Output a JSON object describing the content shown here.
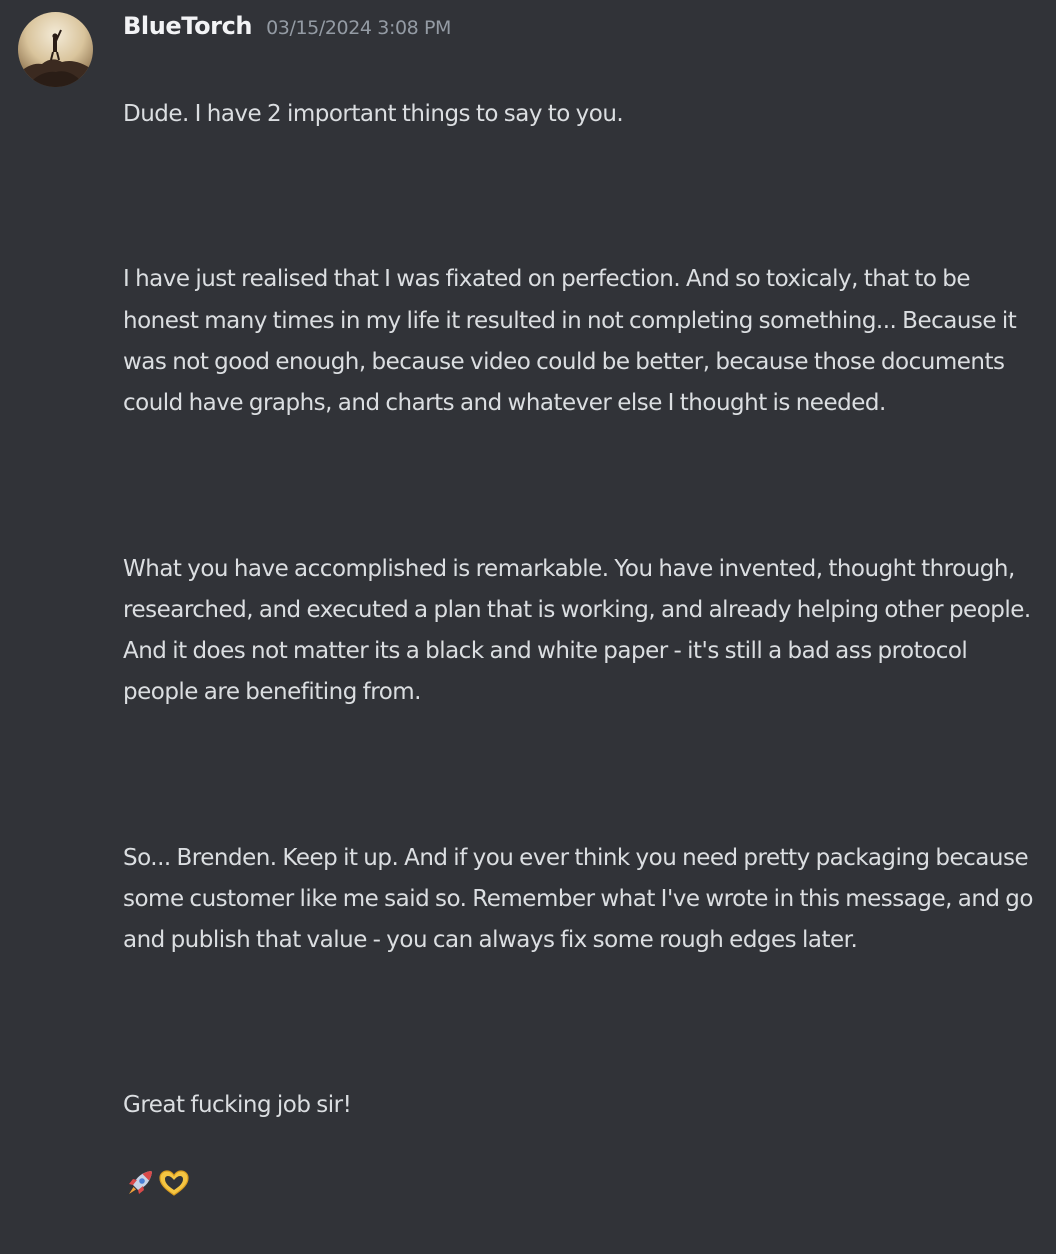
{
  "message": {
    "author": "BlueTorch",
    "timestamp": "03/15/2024 3:08 PM",
    "paragraphs": [
      "Dude. I have 2 important things to say to you.",
      "I have just realised that I was fixated on perfection. And so toxicaly, that to be honest many times in my life it resulted in not completing something... Because it was not good enough, because video could be better, because those documents could have graphs, and charts and whatever else I thought is needed.",
      "What you have accomplished is remarkable. You have invented, thought through, researched, and executed a plan that is working, and already helping other people. And it does not matter its a black and white paper - it's still a bad ass protocol people are benefiting from.",
      "So... Brenden. Keep it up. And if you ever think you need pretty packaging because some customer like me said so. Remember what I've wrote in this message, and go and publish that value - you can always fix some rough edges later.",
      "Great fucking job sir!"
    ],
    "emojis": [
      "rocket-emoji",
      "heart-hands-emoji"
    ]
  },
  "colors": {
    "background": "#313338",
    "username": "#f2f3f5",
    "timestamp": "#949ba4",
    "text": "#dbdee1"
  }
}
